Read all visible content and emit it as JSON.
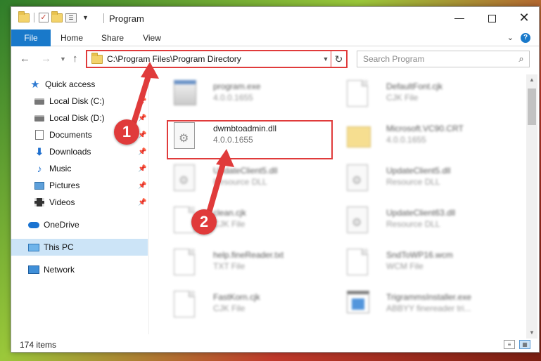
{
  "window": {
    "title": "Program",
    "controls": {
      "minimize": "—",
      "maximize": "",
      "close": "✕"
    }
  },
  "ribbon": {
    "tabs": [
      "File",
      "Home",
      "Share",
      "View"
    ],
    "expand": "⌄",
    "help": "?"
  },
  "navigation": {
    "address": "C:\\Program Files\\Program Directory",
    "search_placeholder": "Search Program"
  },
  "sidebar": {
    "items": [
      {
        "label": "Quick access",
        "icon": "star-icon",
        "pinned": false
      },
      {
        "label": "Local Disk (C:)",
        "icon": "disk-icon",
        "pinned": true
      },
      {
        "label": "Local Disk (D:)",
        "icon": "disk-icon",
        "pinned": true
      },
      {
        "label": "Documents",
        "icon": "documents-icon",
        "pinned": true
      },
      {
        "label": "Downloads",
        "icon": "downloads-icon",
        "pinned": true
      },
      {
        "label": "Music",
        "icon": "music-icon",
        "pinned": true
      },
      {
        "label": "Pictures",
        "icon": "pictures-icon",
        "pinned": true
      },
      {
        "label": "Videos",
        "icon": "videos-icon",
        "pinned": true
      },
      {
        "label": "OneDrive",
        "icon": "onedrive-icon",
        "pinned": false
      },
      {
        "label": "This PC",
        "icon": "pc-icon",
        "pinned": false,
        "selected": true
      },
      {
        "label": "Network",
        "icon": "network-icon",
        "pinned": false
      }
    ]
  },
  "files": {
    "left": [
      {
        "name": "program.exe",
        "desc": "4.0.0.1655",
        "icon": "exe-icon"
      },
      {
        "name": "dwmbtoadmin.dll",
        "desc": "4.0.0.1655",
        "icon": "dll-gear-icon",
        "highlighted": true
      },
      {
        "name": "UpdateClient5.dll",
        "desc": "Resource DLL",
        "icon": "dll-gear-icon"
      },
      {
        "name": "clean.cjk",
        "desc": "CJK File",
        "icon": "document-icon"
      },
      {
        "name": "help.fineReader.txt",
        "desc": "TXT File",
        "icon": "document-icon"
      },
      {
        "name": "FastKorn.cjk",
        "desc": "CJK File",
        "icon": "document-icon"
      }
    ],
    "right": [
      {
        "name": "DefaultFont.cjk",
        "desc": "CJK File",
        "icon": "document-icon"
      },
      {
        "name": "Microsoft.VC90.CRT",
        "desc": "4.0.0.1655",
        "icon": "folder-icon"
      },
      {
        "name": "UpdateClient5.dll",
        "desc": "Resource DLL",
        "icon": "dll-gear-icon"
      },
      {
        "name": "UpdateClient63.dll",
        "desc": "Resource DLL",
        "icon": "dll-gear-icon"
      },
      {
        "name": "SndToWP16.wcm",
        "desc": "WCM File",
        "icon": "document-icon"
      },
      {
        "name": "TrigrammsInstaller.exe",
        "desc": "ABBYY finereader tri...",
        "icon": "installer-icon"
      }
    ]
  },
  "status": {
    "count": "174 items"
  },
  "annotations": {
    "step1": "1",
    "step2": "2"
  },
  "colors": {
    "accent": "#1979ca",
    "highlight": "#e03b3b",
    "selection": "#cce4f7"
  }
}
